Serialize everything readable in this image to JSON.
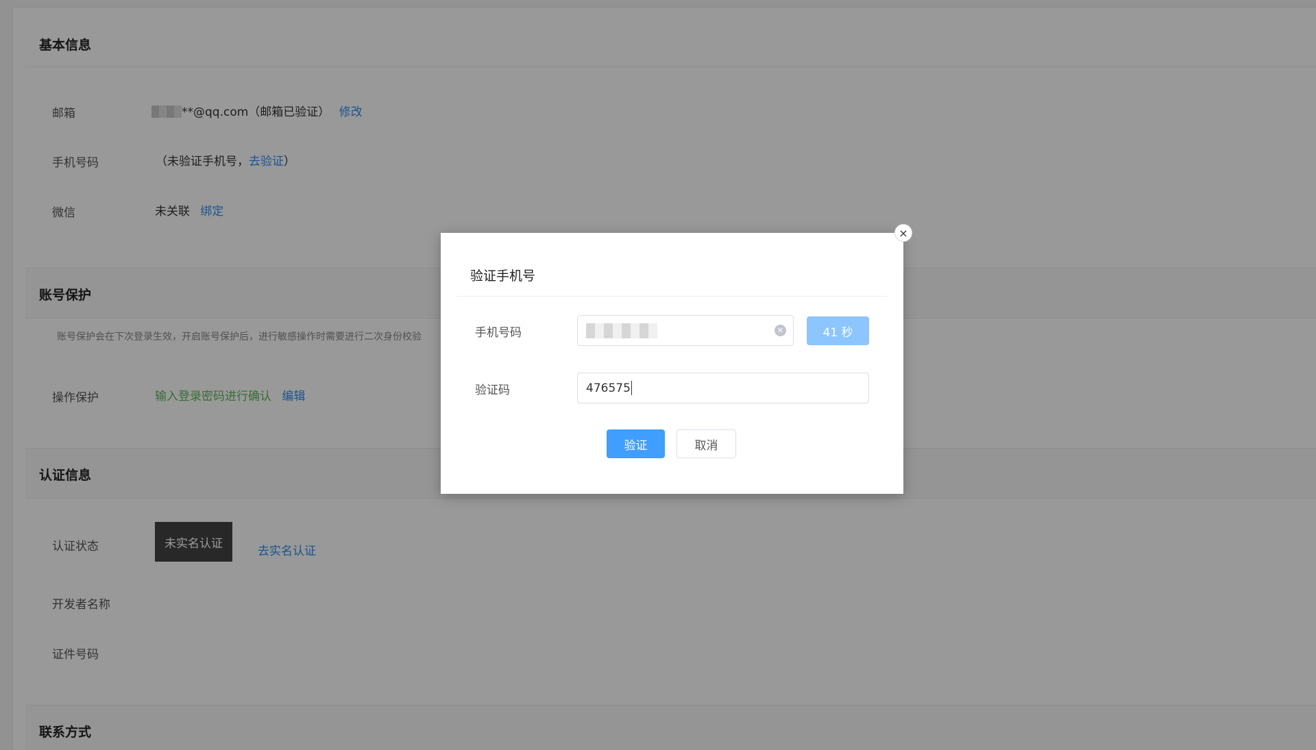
{
  "basic_info": {
    "title": "基本信息",
    "email_label": "邮箱",
    "email_value": "**@qq.com（邮箱已验证）",
    "email_edit": "修改",
    "phone_label": "手机号码",
    "phone_prefix": "（未验证手机号，",
    "phone_verify": "去验证",
    "phone_suffix": "）",
    "wechat_label": "微信",
    "wechat_value": "未关联",
    "wechat_bind": "绑定"
  },
  "account_protection": {
    "title": "账号保护",
    "hint": "账号保护会在下次登录生效，开启账号保护后，进行敏感操作时需要进行二次身份校验",
    "op_label": "操作保护",
    "op_value": "输入登录密码进行确认",
    "op_edit": "编辑"
  },
  "certification": {
    "title": "认证信息",
    "status_label": "认证状态",
    "status_badge": "未实名认证",
    "status_link": "去实名认证",
    "dev_name_label": "开发者名称",
    "id_label": "证件号码"
  },
  "contact": {
    "title": "联系方式"
  },
  "modal": {
    "title": "验证手机号",
    "phone_label": "手机号码",
    "countdown": "41 秒",
    "code_label": "验证码",
    "code_value": "476575",
    "confirm": "验证",
    "cancel": "取消",
    "close": "×"
  }
}
